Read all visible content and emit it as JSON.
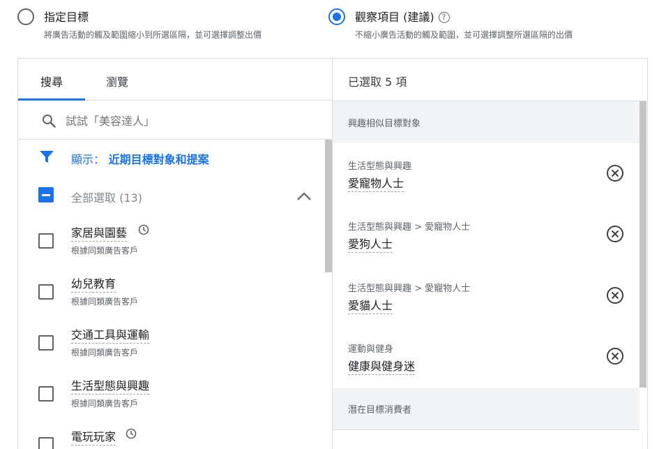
{
  "targeting": {
    "option_narrow": {
      "title": "指定目標",
      "description": "將廣告活動的觸及範圍縮小到所選區隔，並可選擇調整出價",
      "selected": false
    },
    "option_observe": {
      "title": "觀察項目 (建議)",
      "description": "不縮小廣告活動的觸及範圍，並可選擇調整所選區隔的出價",
      "selected": true
    }
  },
  "left_panel": {
    "tabs": [
      {
        "label": "搜尋",
        "active": true
      },
      {
        "label": "瀏覽",
        "active": false
      }
    ],
    "search": {
      "placeholder": "試試「美容達人」",
      "value": ""
    },
    "filter": {
      "prefix": "顯示：",
      "value": "近期目標對象和提案"
    },
    "select_all": {
      "label": "全部選取 (13)",
      "state": "indeterminate"
    },
    "categories": [
      {
        "name": "家居與園藝",
        "source": "根據同類廣告客戶",
        "has_history": true
      },
      {
        "name": "幼兒教育",
        "source": "根據同類廣告客戶",
        "has_history": false
      },
      {
        "name": "交通工具與運輸",
        "source": "根據同類廣告客戶",
        "has_history": false
      },
      {
        "name": "生活型態與興趣",
        "source": "根據同類廣告客戶",
        "has_history": false
      },
      {
        "name": "電玩玩家",
        "source": "",
        "has_history": true
      }
    ]
  },
  "right_panel": {
    "selected_count_label": "已選取 5 項",
    "groups": [
      {
        "title": "興趣相似目標對象",
        "items": [
          {
            "path": "生活型態與興趣",
            "name": "愛寵物人士"
          },
          {
            "path": "生活型態與興趣 > 愛寵物人士",
            "name": "愛狗人士"
          },
          {
            "path": "生活型態與興趣 > 愛寵物人士",
            "name": "愛貓人士"
          },
          {
            "path": "運動與健身",
            "name": "健康與健身迷"
          }
        ]
      },
      {
        "title": "潛在目標消費者",
        "items": []
      }
    ]
  },
  "colors": {
    "accent": "#1a73e8",
    "text_primary": "#202124",
    "text_secondary": "#5f6368",
    "divider": "#dadce0",
    "group_header_bg": "#f1f3f4"
  },
  "icons": {
    "help": "help-circle-icon",
    "search": "search-icon",
    "filter": "filter-funnel-icon",
    "history": "clock-icon",
    "collapse": "chevron-up-icon",
    "remove": "remove-circle-x-icon"
  }
}
